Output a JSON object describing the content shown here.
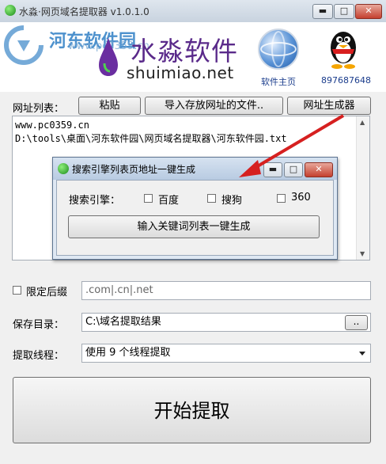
{
  "window": {
    "title": "水淼·网页域名提取器 v1.0.1.0",
    "min_label": "▬",
    "max_label": "□",
    "close_label": "✕"
  },
  "banner": {
    "watermark_title": "河东软件园",
    "watermark_url": "www.pc0359.cn",
    "brand_cn": "水淼软件",
    "brand_en": "shuimiao.net",
    "homepage_label": "软件主页",
    "qq_number": "897687648"
  },
  "url_list": {
    "label": "网址列表：",
    "paste_button": "粘贴",
    "import_button": "导入存放网址的文件..",
    "generator_button": "网址生成器",
    "lines": [
      "www.pc0359.cn",
      "D:\\tools\\桌面\\河东软件园\\网页域名提取器\\河东软件园.txt"
    ]
  },
  "dialog": {
    "title": "搜索引擎列表页地址一键生成",
    "engine_label": "搜索引擎：",
    "engines": [
      "百度",
      "搜狗",
      "360"
    ],
    "generate_button": "输入关键词列表一键生成"
  },
  "suffix": {
    "checkbox_label": "限定后缀",
    "value": ".com|.cn|.net"
  },
  "save_dir": {
    "label": "保存目录：",
    "value": "C:\\域名提取结果",
    "browse_button": ".."
  },
  "threads": {
    "label": "提取线程：",
    "selected": "使用 9 个线程提取"
  },
  "start_button": "开始提取",
  "colors": {
    "brand_purple": "#5a2a8a",
    "close_red": "#c4402f",
    "arrow_red": "#d62020"
  }
}
